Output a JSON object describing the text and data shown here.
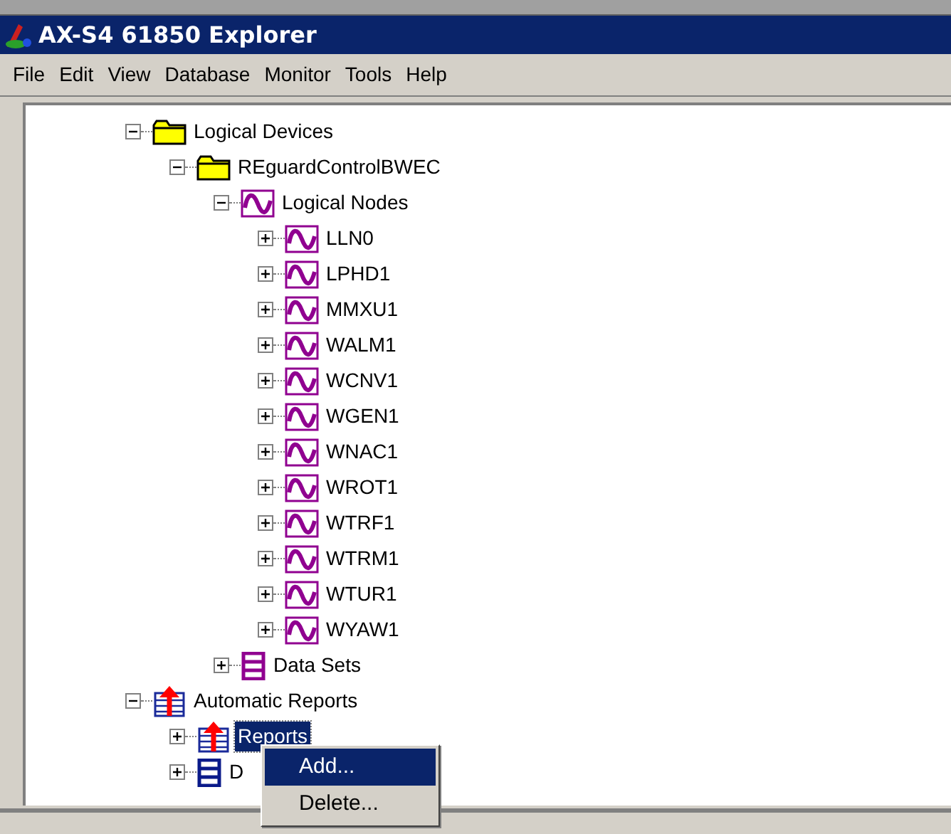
{
  "window": {
    "title": "AX-S4 61850 Explorer"
  },
  "menu": [
    "File",
    "Edit",
    "View",
    "Database",
    "Monitor",
    "Tools",
    "Help"
  ],
  "tree": [
    {
      "label": "Logical Devices",
      "kind": "folder",
      "expanded": true,
      "selected": false,
      "children": [
        {
          "label": "REguardControlBWEC",
          "kind": "folder",
          "expanded": true,
          "selected": false,
          "children": [
            {
              "label": "Logical Nodes",
              "kind": "node",
              "expanded": true,
              "selected": false,
              "children": [
                {
                  "label": "LLN0",
                  "kind": "node",
                  "expanded": false,
                  "selected": false
                },
                {
                  "label": "LPHD1",
                  "kind": "node",
                  "expanded": false,
                  "selected": false
                },
                {
                  "label": "MMXU1",
                  "kind": "node",
                  "expanded": false,
                  "selected": false
                },
                {
                  "label": "WALM1",
                  "kind": "node",
                  "expanded": false,
                  "selected": false
                },
                {
                  "label": "WCNV1",
                  "kind": "node",
                  "expanded": false,
                  "selected": false
                },
                {
                  "label": "WGEN1",
                  "kind": "node",
                  "expanded": false,
                  "selected": false
                },
                {
                  "label": "WNAC1",
                  "kind": "node",
                  "expanded": false,
                  "selected": false
                },
                {
                  "label": "WROT1",
                  "kind": "node",
                  "expanded": false,
                  "selected": false
                },
                {
                  "label": "WTRF1",
                  "kind": "node",
                  "expanded": false,
                  "selected": false
                },
                {
                  "label": "WTRM1",
                  "kind": "node",
                  "expanded": false,
                  "selected": false
                },
                {
                  "label": "WTUR1",
                  "kind": "node",
                  "expanded": false,
                  "selected": false
                },
                {
                  "label": "WYAW1",
                  "kind": "node",
                  "expanded": false,
                  "selected": false
                }
              ]
            },
            {
              "label": "Data Sets",
              "kind": "dataset",
              "expanded": false,
              "selected": false
            }
          ]
        }
      ]
    },
    {
      "label": "Automatic Reports",
      "kind": "report",
      "expanded": true,
      "selected": false,
      "children": [
        {
          "label": "Reports",
          "kind": "report",
          "expanded": false,
          "selected": true
        },
        {
          "label": "D",
          "kind": "list",
          "expanded": false,
          "selected": false
        }
      ]
    }
  ],
  "context_menu": [
    {
      "label": "Add...",
      "selected": true
    },
    {
      "label": "Delete...",
      "selected": false
    }
  ]
}
